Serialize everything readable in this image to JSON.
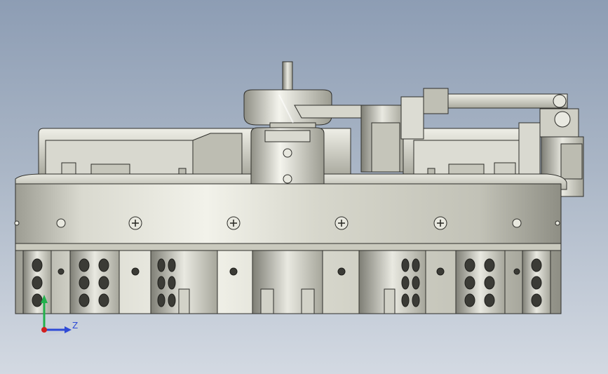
{
  "viewport": {
    "background_top": "#8d9db4",
    "background_bottom": "#d3d9e2"
  },
  "model": {
    "metal_color": "#cfcfc4",
    "edge_color": "#2e2e2a",
    "hole_color": "#3b3b36"
  },
  "triad": {
    "axis_y_color": "#22b14c",
    "axis_z_color": "#2f4bd6",
    "origin_color": "#d22020",
    "z_label": "Z",
    "icon": "coordinate-triad-icon"
  }
}
